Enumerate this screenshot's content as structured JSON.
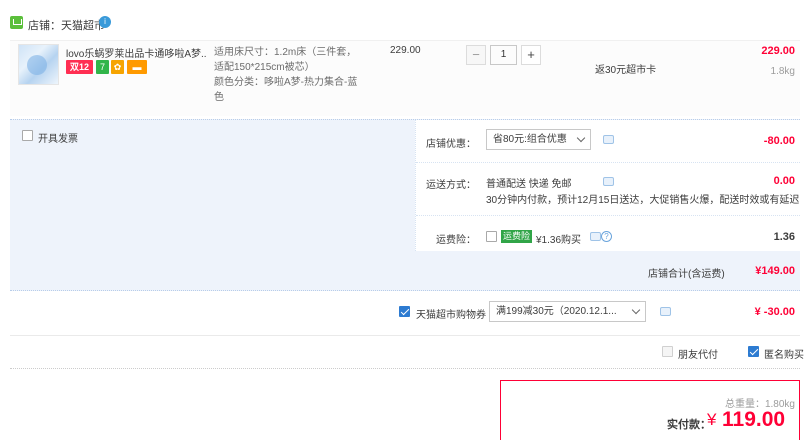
{
  "store": {
    "label": "店铺：天猫超市",
    "badge": "i"
  },
  "item": {
    "title": "lovo乐蜗罗莱出品卡通哆啦A梦...",
    "tags": [
      "双12",
      "7",
      "✿",
      "▬"
    ],
    "sku_size": "适用床尺寸：1.2m床（三件套，适配150*215cm被芯）",
    "sku_color": "颜色分类：哆啦A梦-热力集合-蓝色",
    "unit_price": "229.00",
    "quantity": "1",
    "minus": "−",
    "plus": "+",
    "promo": "返30元超市卡",
    "total": "229.00",
    "weight": "1.8kg"
  },
  "invoice": {
    "label": "开具发票",
    "checked": false
  },
  "shop_discount": {
    "label": "店铺优惠：",
    "selected": "省80元:组合优惠",
    "amount": "-80.00"
  },
  "shipping": {
    "label": "运送方式：",
    "line1": "普通配送 快递 免邮",
    "line2": "30分钟内付款，预计12月15日送达，大促销售火爆，配送时效或有延迟",
    "amount": "0.00"
  },
  "freight_insurance": {
    "label": "运费险：",
    "tag": "运费险",
    "desc": "¥1.36购买",
    "amount": "1.36",
    "checked": false
  },
  "store_total": {
    "label": "店铺合计(含运费)",
    "amount": "¥149.00"
  },
  "coupon": {
    "label": "天猫超市购物券",
    "selected": "满199减30元（2020.12.1...",
    "amount": "¥ -30.00",
    "checked": true
  },
  "options": {
    "friend_pay": "朋友代付",
    "friend_pay_checked": false,
    "anonymous": "匿名购买",
    "anonymous_checked": true
  },
  "payment": {
    "total_weight": "总重量：1.80kg",
    "pay_label": "实付款：",
    "currency": "¥",
    "amount": "119.00"
  },
  "colors": {
    "accent_red": "#ff0036",
    "link_blue": "#2d7bd1",
    "panel_blue": "#eef3fb",
    "tmall_green": "#31a548"
  }
}
